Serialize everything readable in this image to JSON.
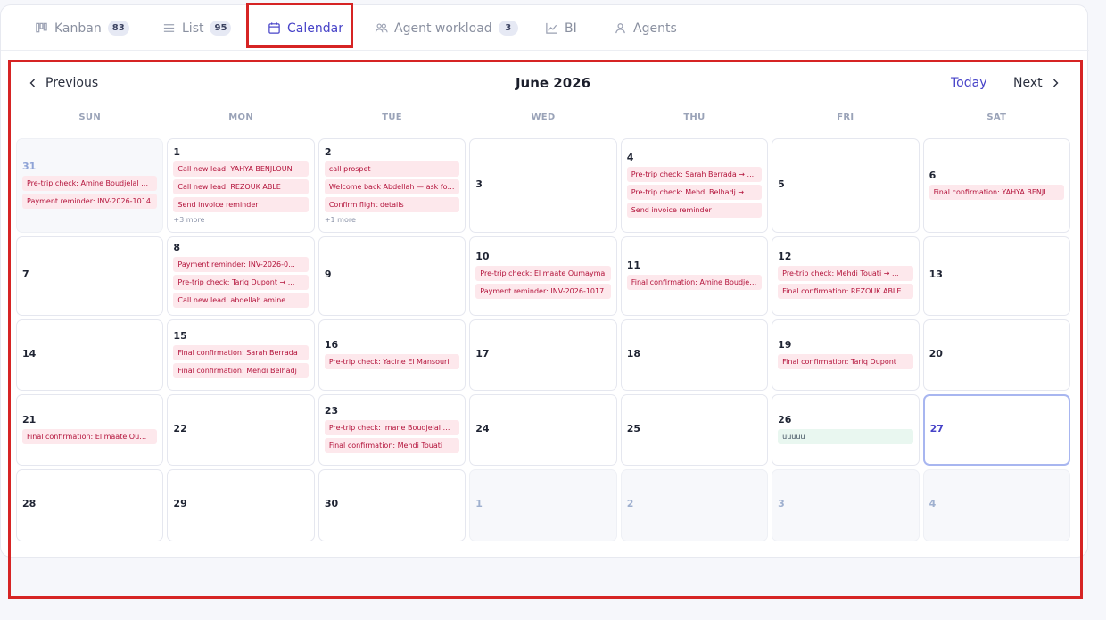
{
  "tabs": [
    {
      "label": "Kanban",
      "badge": "83",
      "icon": "kanban-icon"
    },
    {
      "label": "List",
      "badge": "95",
      "icon": "list-icon"
    },
    {
      "label": "Calendar",
      "badge": "",
      "icon": "calendar-icon",
      "active": true
    },
    {
      "label": "Agent workload",
      "badge": "3",
      "icon": "users-icon"
    },
    {
      "label": "BI",
      "badge": "",
      "icon": "chart-line-icon"
    },
    {
      "label": "Agents",
      "badge": "",
      "icon": "user-icon"
    }
  ],
  "calendar": {
    "title": "June 2026",
    "prev_label": "Previous",
    "today_label": "Today",
    "next_label": "Next",
    "weekdays": [
      "SUN",
      "MON",
      "TUE",
      "WED",
      "THU",
      "FRI",
      "SAT"
    ],
    "days": [
      {
        "day": "31",
        "outside": true,
        "events": [
          "Pre-trip check: Amine Boudjelal → ...",
          "Payment reminder: INV-2026-1014"
        ]
      },
      {
        "day": "1",
        "events": [
          "Call new lead: YAHYA BENJLOUN",
          "Call new lead: REZOUK ABLE",
          "Send invoice reminder"
        ],
        "more": "+3 more"
      },
      {
        "day": "2",
        "events": [
          "call prospet",
          "Welcome back Abdellah — ask for feedback",
          "Confirm flight details"
        ],
        "more": "+1 more"
      },
      {
        "day": "3",
        "events": []
      },
      {
        "day": "4",
        "events": [
          "Pre-trip check: Sarah Berrada → ...",
          "Pre-trip check: Mehdi Belhadj → ...",
          "Send invoice reminder"
        ]
      },
      {
        "day": "5",
        "events": []
      },
      {
        "day": "6",
        "events": [
          "Final confirmation: YAHYA BENJLOUN"
        ]
      },
      {
        "day": "7",
        "events": []
      },
      {
        "day": "8",
        "events": [
          "Payment reminder: INV-2026-0...",
          "Pre-trip check: Tariq Dupont → ...",
          "Call new lead: abdellah amine"
        ]
      },
      {
        "day": "9",
        "events": []
      },
      {
        "day": "10",
        "events": [
          "Pre-trip check: El maate Oumayma",
          "Payment reminder: INV-2026-1017"
        ]
      },
      {
        "day": "11",
        "events": [
          "Final confirmation: Amine Boudjelal"
        ]
      },
      {
        "day": "12",
        "events": [
          "Pre-trip check: Mehdi Touati → ...",
          "Final confirmation: REZOUK ABLE"
        ]
      },
      {
        "day": "13",
        "events": []
      },
      {
        "day": "14",
        "events": []
      },
      {
        "day": "15",
        "events": [
          "Final confirmation: Sarah Berrada",
          "Final confirmation: Mehdi Belhadj"
        ]
      },
      {
        "day": "16",
        "events": [
          "Pre-trip check: Yacine El Mansouri"
        ]
      },
      {
        "day": "17",
        "events": []
      },
      {
        "day": "18",
        "events": []
      },
      {
        "day": "19",
        "events": [
          "Final confirmation: Tariq Dupont"
        ]
      },
      {
        "day": "20",
        "events": []
      },
      {
        "day": "21",
        "events": [
          "Final confirmation: El maate Oumayma"
        ]
      },
      {
        "day": "22",
        "events": []
      },
      {
        "day": "23",
        "events": [
          "Pre-trip check: Imane Boudjelal → ...",
          "Final confirmation: Mehdi Touati"
        ]
      },
      {
        "day": "24",
        "events": []
      },
      {
        "day": "25",
        "events": []
      },
      {
        "day": "26",
        "events": [],
        "green_events": [
          "uuuuu"
        ]
      },
      {
        "day": "27",
        "today": true,
        "events": []
      },
      {
        "day": "28",
        "events": []
      },
      {
        "day": "29",
        "events": []
      },
      {
        "day": "30",
        "events": []
      },
      {
        "day": "1",
        "outside": true,
        "events": []
      },
      {
        "day": "2",
        "outside": true,
        "events": []
      },
      {
        "day": "3",
        "outside": true,
        "events": []
      },
      {
        "day": "4",
        "outside": true,
        "events": []
      }
    ]
  },
  "colors": {
    "accent": "#4743c8",
    "event_bg": "#fde8ec",
    "event_text": "#b3123a",
    "highlight": "#d62424"
  }
}
